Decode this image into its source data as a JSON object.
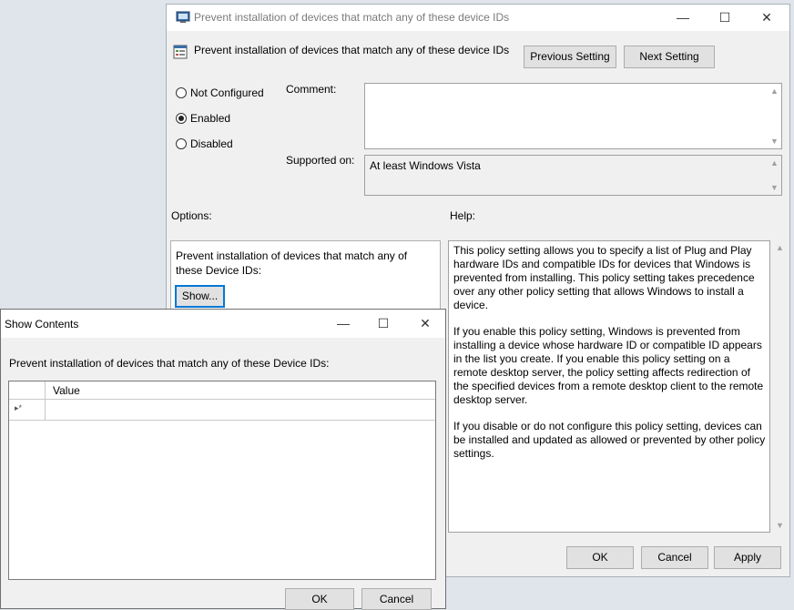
{
  "main_window": {
    "title": "Prevent installation of devices that match any of these device IDs",
    "header_title": "Prevent installation of devices that match any of these device IDs",
    "previous_setting": "Previous Setting",
    "next_setting": "Next Setting",
    "radios": [
      {
        "label": "Not Configured",
        "checked": false
      },
      {
        "label": "Enabled",
        "checked": true
      },
      {
        "label": "Disabled",
        "checked": false
      }
    ],
    "comment_label": "Comment:",
    "comment_value": "",
    "supported_label": "Supported on:",
    "supported_value": "At least Windows Vista",
    "options_label": "Options:",
    "help_label": "Help:",
    "option_text": "Prevent installation of devices that match any of these Device IDs:",
    "show_button": "Show...",
    "help_paragraphs": [
      "This policy setting allows you to specify a list of Plug and Play hardware IDs and compatible IDs for devices that Windows is prevented from installing. This policy setting takes precedence over any other policy setting that allows Windows to install a device.",
      "If you enable this policy setting, Windows is prevented from installing a device whose hardware ID or compatible ID appears in the list you create. If you enable this policy setting on a remote desktop server, the policy setting affects redirection of the specified devices from a remote desktop client to the remote desktop server.",
      "If you disable or do not configure this policy setting, devices can be installed and updated as allowed or prevented by other policy settings."
    ],
    "ok": "OK",
    "cancel": "Cancel",
    "apply": "Apply"
  },
  "dialog": {
    "title": "Show Contents",
    "description": "Prevent installation of devices that match any of these Device IDs:",
    "column_header": "Value",
    "new_row_marker": "▸*",
    "ok": "OK",
    "cancel": "Cancel"
  },
  "icons": [
    "policy-icon",
    "minimize-icon",
    "maximize-icon",
    "close-icon",
    "scroll-up-icon",
    "scroll-down-icon"
  ]
}
